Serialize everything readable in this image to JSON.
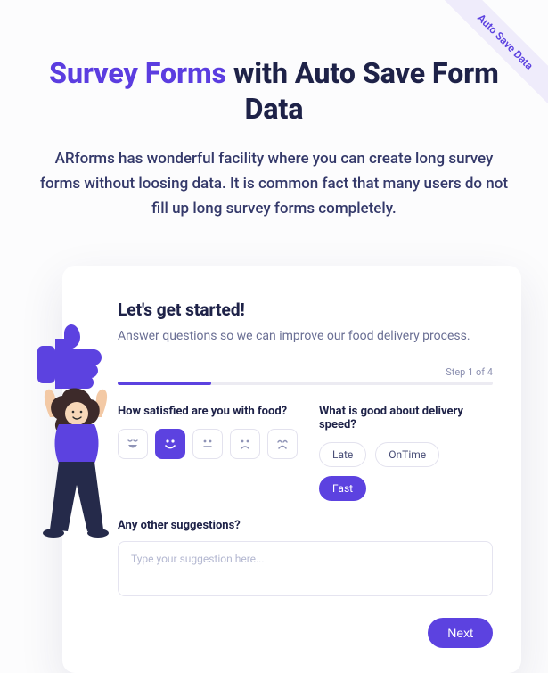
{
  "ribbon": {
    "label": "Auto Save Data"
  },
  "hero": {
    "title_accent": "Survey Forms",
    "title_rest": "with Auto Save Form Data",
    "description": "ARforms has wonderful facility where you can create long survey forms without loosing data. It is common fact that many users do not fill up long survey forms completely."
  },
  "card": {
    "title": "Let's get started!",
    "subtitle": "Answer questions so we can improve our food delivery process.",
    "progress": {
      "step_text": "Step 1 of 4",
      "percent": 25
    },
    "q_satisfaction": {
      "label": "How satisfied are you with food?",
      "options": [
        {
          "name": "laughing",
          "selected": false
        },
        {
          "name": "happy",
          "selected": true
        },
        {
          "name": "neutral",
          "selected": false
        },
        {
          "name": "sad",
          "selected": false
        },
        {
          "name": "crying",
          "selected": false
        }
      ]
    },
    "q_speed": {
      "label": "What is good about delivery speed?",
      "options": [
        {
          "label": "Late",
          "selected": false
        },
        {
          "label": "OnTime",
          "selected": false
        },
        {
          "label": "Fast",
          "selected": true
        }
      ]
    },
    "q_suggestions": {
      "label": "Any other suggestions?",
      "placeholder": "Type your suggestion here...",
      "value": ""
    },
    "next_label": "Next"
  },
  "colors": {
    "accent": "#5c42e0"
  }
}
